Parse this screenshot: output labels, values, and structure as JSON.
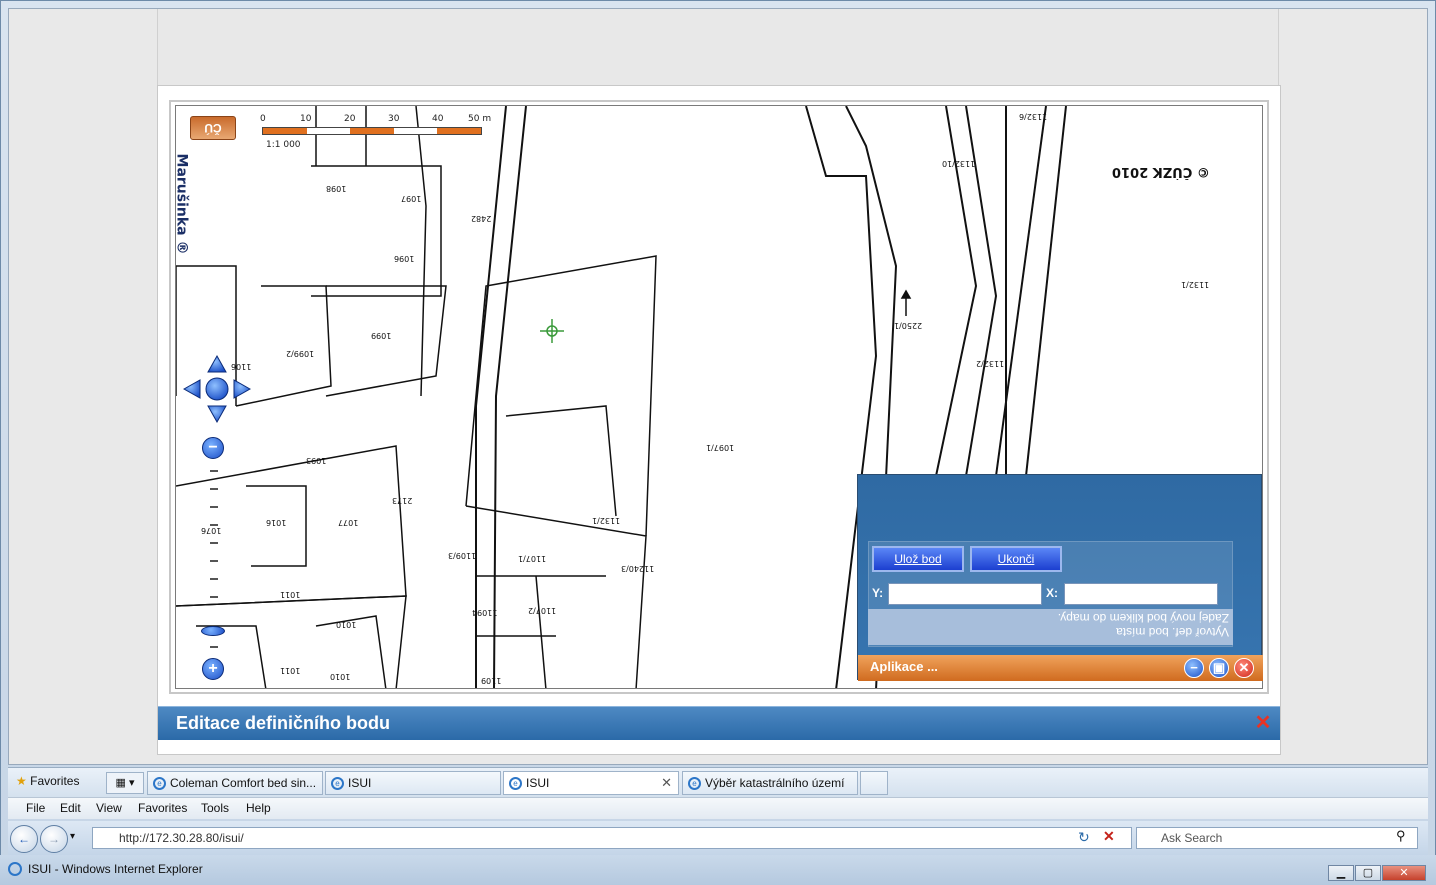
{
  "window": {
    "title": "ISUI - Windows Internet Explorer"
  },
  "browser": {
    "menu": [
      "File",
      "Edit",
      "View",
      "Favorites",
      "Tools",
      "Help"
    ],
    "address": "http://172.30.28.80/isui/",
    "search_placeholder": "Ask Search",
    "favorites_label": "Favorites",
    "tabs": [
      {
        "label": "Coleman Comfort bed sin..."
      },
      {
        "label": "ISUI"
      },
      {
        "label": "ISUI",
        "active": true
      },
      {
        "label": "Výběr katastrálního území"
      }
    ]
  },
  "dialog": {
    "title": "Editace definičního bodu",
    "close_symbol": "✕"
  },
  "map": {
    "copyright": "© ČÚZK 2010",
    "scale_text": "1:1 000",
    "scale_marks": [
      "0",
      "10",
      "20",
      "30",
      "40",
      "50 m"
    ],
    "street_label": "Marušinka ®",
    "parcels": [
      "1097",
      "1098",
      "1096",
      "1099",
      "2482",
      "1106",
      "1099/2",
      "1093",
      "1097/1",
      "2173",
      "1076",
      "1016",
      "1077",
      "1011",
      "1010",
      "1011",
      "1010",
      "1109",
      "1107/1",
      "1109/3",
      "1107/2",
      "11094",
      "1132/1",
      "11240/3",
      "2250/1",
      "1132/2",
      "1132/10",
      "1132/6",
      "1132/1"
    ]
  },
  "app_panel": {
    "save_button": "Ulož bod",
    "end_button": "Ukonči",
    "y_label": "Y:",
    "x_label": "X:",
    "y_value": "",
    "x_value": "",
    "instruction_line1": "Zadej nový bod klikem do mapy.",
    "instruction_line2": "Vytvoř def. bod místa",
    "footer_label": "Aplikace ..."
  },
  "colors": {
    "dialog_title_bg": "#2b6aa8",
    "panel_bg": "#2f6aa3",
    "panel_footer": "#d06b1f",
    "button_bg": "#1c3fd0",
    "close_red": "#e83324"
  }
}
